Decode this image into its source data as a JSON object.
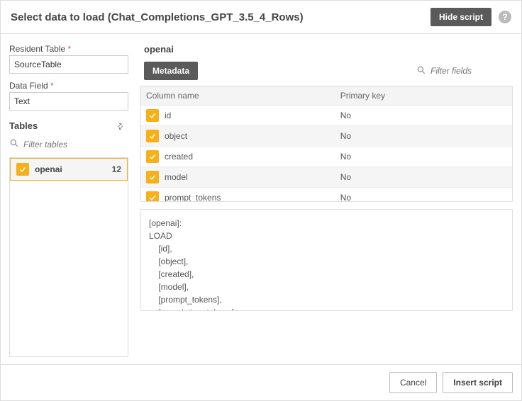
{
  "header": {
    "title": "Select data to load (Chat_Completions_GPT_3.5_4_Rows)",
    "hide_script": "Hide script",
    "help_tooltip": "?"
  },
  "left": {
    "resident_table_label": "Resident Table",
    "resident_table_value": "SourceTable",
    "data_field_label": "Data Field",
    "data_field_value": "Text",
    "tables_label": "Tables",
    "filter_tables_placeholder": "Filter tables",
    "table_items": [
      {
        "name": "openai",
        "count": "12",
        "checked": true
      }
    ]
  },
  "right": {
    "connection_title": "openai",
    "metadata_btn": "Metadata",
    "filter_fields_placeholder": "Filter fields",
    "column_name_header": "Column name",
    "primary_key_header": "Primary key",
    "columns": [
      {
        "name": "id",
        "primary_key": "No",
        "checked": true
      },
      {
        "name": "object",
        "primary_key": "No",
        "checked": true
      },
      {
        "name": "created",
        "primary_key": "No",
        "checked": true
      },
      {
        "name": "model",
        "primary_key": "No",
        "checked": true
      },
      {
        "name": "prompt_tokens",
        "primary_key": "No",
        "checked": true
      }
    ],
    "script_text": "[openai]:\nLOAD\n    [id],\n    [object],\n    [created],\n    [model],\n    [prompt_tokens],\n    [completion_tokens],\n    [total_tokens],"
  },
  "footer": {
    "cancel": "Cancel",
    "insert": "Insert script"
  }
}
